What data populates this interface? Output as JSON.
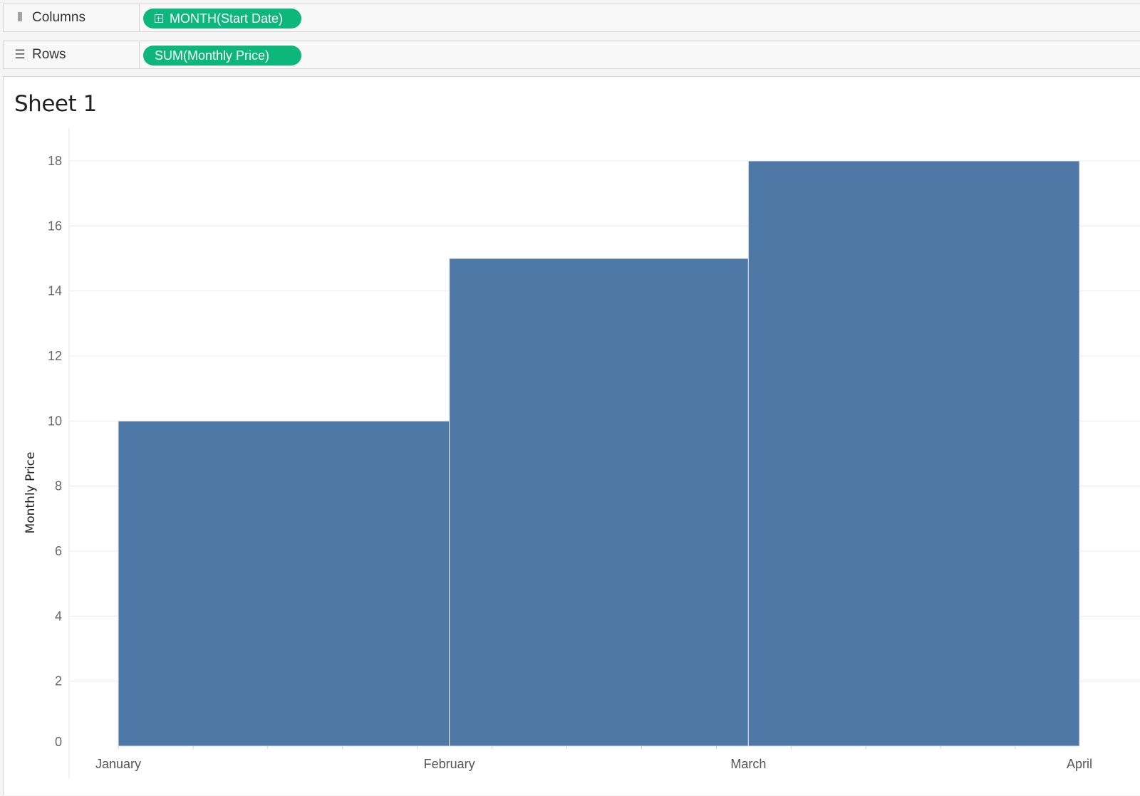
{
  "shelves": {
    "columns": {
      "label": "Columns",
      "pill": "MONTH(Start Date)"
    },
    "rows": {
      "label": "Rows",
      "pill": "SUM(Monthly Price)"
    }
  },
  "sheet": {
    "title": "Sheet 1"
  },
  "colors": {
    "pill": "#0db77b",
    "bar": "#4e79a7"
  },
  "chart_data": {
    "type": "bar",
    "title": "",
    "xlabel": "",
    "ylabel": "Monthly Price",
    "categories": [
      "January",
      "February",
      "March"
    ],
    "x_ticks": [
      "January",
      "February",
      "March",
      "April"
    ],
    "x_tick_days": [
      0,
      31,
      59,
      90
    ],
    "values": [
      10,
      15,
      18
    ],
    "ylim": [
      0,
      18
    ],
    "y_ticks": [
      0,
      2,
      4,
      6,
      8,
      10,
      12,
      14,
      16,
      18
    ],
    "grid": true,
    "legend": "none"
  }
}
